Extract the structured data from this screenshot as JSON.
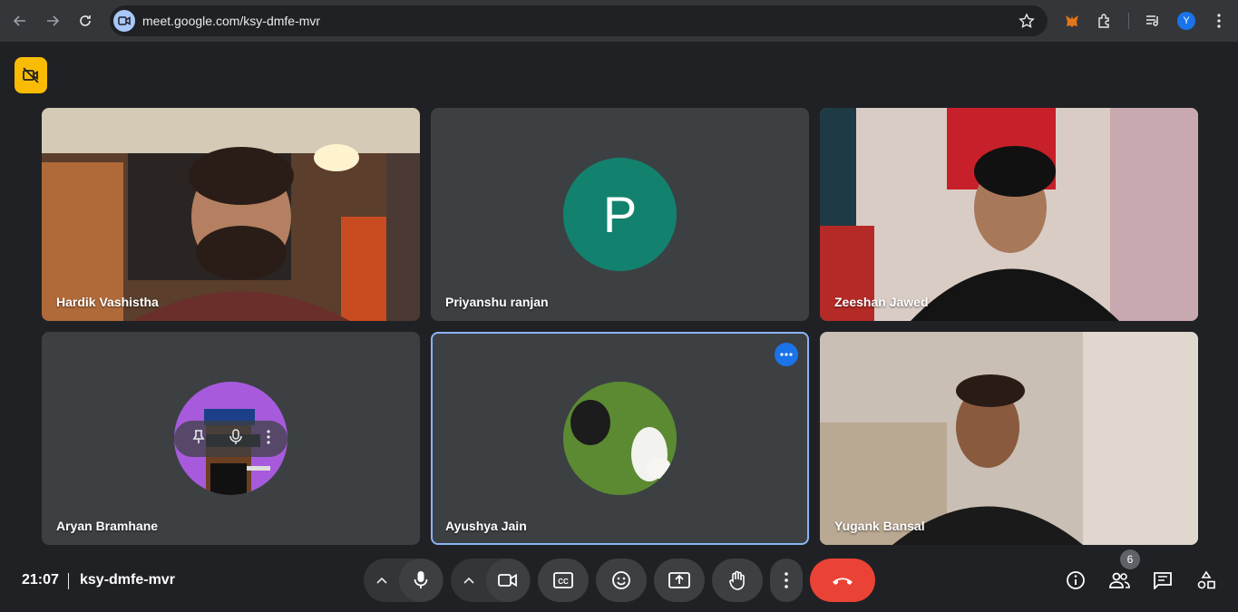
{
  "browser": {
    "url": "meet.google.com/ksy-dmfe-mvr",
    "profile_initial": "Y"
  },
  "participants": [
    {
      "name": "Hardik Vashistha",
      "video": true,
      "bg": "#6b4a33"
    },
    {
      "name": "Priyanshu ranjan",
      "video": false,
      "avatar_letter": "P",
      "avatar_color": "#12826f"
    },
    {
      "name": "Zeeshan Jawed",
      "video": true,
      "bg": "#c9bdb8"
    },
    {
      "name": "Aryan Bramhane",
      "video": false,
      "avatar_color": "#a75bdc"
    },
    {
      "name": "Ayushya Jain",
      "video": false,
      "avatar_color": "#4d7a2c",
      "selected": true
    },
    {
      "name": "Yugank Bansal",
      "video": true,
      "bg": "#bdb3a8"
    }
  ],
  "meeting": {
    "time": "21:07",
    "code": "ksy-dmfe-mvr",
    "participant_count": "6"
  },
  "colors": {
    "accent": "#8ab4f8",
    "end_call": "#ea4335",
    "warning": "#f9bc02"
  }
}
